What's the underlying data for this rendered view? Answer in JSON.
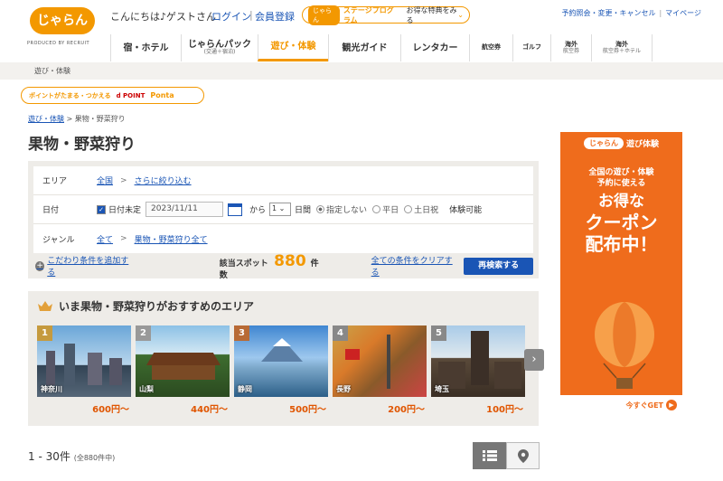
{
  "header": {
    "logo_text": "じゃらん",
    "logo_sub": "PRODUCED BY RECRUIT",
    "greeting": "こんにちは♪ゲストさん",
    "login": "ログイン",
    "separator": "|",
    "register": "会員登録",
    "stage_logo": "じゃらん",
    "stage_program": "ステージプログラム",
    "stage_desc": "お得な特典をみる",
    "top_links": [
      "予約照会・変更・キャンセル",
      "マイページ"
    ]
  },
  "nav": {
    "items": [
      {
        "label": "宿・ホテル",
        "sub": ""
      },
      {
        "label": "じゃらんパック",
        "sub": "(交通＋宿泊)"
      },
      {
        "label": "遊び・体験",
        "sub": ""
      },
      {
        "label": "観光ガイド",
        "sub": ""
      },
      {
        "label": "レンタカー",
        "sub": ""
      },
      {
        "label": "航空券",
        "sub": ""
      },
      {
        "label": "ゴルフ",
        "sub": ""
      },
      {
        "label": "海外",
        "sub": "航空券"
      },
      {
        "label": "海外",
        "sub": "航空券＋ホテル"
      }
    ],
    "active_index": 2
  },
  "subcrumb": "遊び・体験",
  "points": {
    "text": "ポイントがたまる・つかえる",
    "dpoint": "d POINT",
    "ponta": "Ponta"
  },
  "breadcrumb": {
    "home": "遊び・体験",
    "gt": ">",
    "current": "果物・野菜狩り"
  },
  "page_title": "果物・野菜狩り",
  "search": {
    "area_label": "エリア",
    "area_value": "全国",
    "area_gt": ">",
    "area_refine": "さらに絞り込む",
    "date_label": "日付",
    "date_undecided": "日付未定",
    "date_value": "2023/11/11",
    "from_text": "から",
    "days_value": "1",
    "days_suffix": "日間",
    "radio_options": [
      "指定しない",
      "平日",
      "土日祝"
    ],
    "radio_selected": 0,
    "experience_available": "体験可能",
    "genre_label": "ジャンル",
    "genre_all": "全て",
    "genre_gt": ">",
    "genre_value": "果物・野菜狩り全て",
    "add_condition": "こだわり条件を追加する",
    "count_label": "該当スポット数",
    "count_value": "880",
    "count_unit": "件",
    "clear_all": "全ての条件をクリアする",
    "search_button": "再検索する"
  },
  "recommend": {
    "title": "いま果物・野菜狩りがおすすめのエリア",
    "areas": [
      {
        "rank": "1",
        "name": "神奈川",
        "price": "600円〜"
      },
      {
        "rank": "2",
        "name": "山梨",
        "price": "440円〜"
      },
      {
        "rank": "3",
        "name": "静岡",
        "price": "500円〜"
      },
      {
        "rank": "4",
        "name": "長野",
        "price": "200円〜"
      },
      {
        "rank": "5",
        "name": "埼玉",
        "price": "100円〜"
      }
    ],
    "next": "›"
  },
  "results": {
    "range": "1 - 30件",
    "total": "(全880件中)"
  },
  "ad": {
    "logo": "じゃらん",
    "logo_text": "遊び体験",
    "line1": "全国の遊び・体験",
    "line2": "予約に使える",
    "big1": "お得な",
    "big2": "クーポン",
    "big3": "配布中！",
    "cta": "今すぐGET"
  },
  "colors": {
    "accent": "#f39800",
    "link": "#1a55b5",
    "ad_bg": "#ef6c1c",
    "price": "#e05500"
  }
}
